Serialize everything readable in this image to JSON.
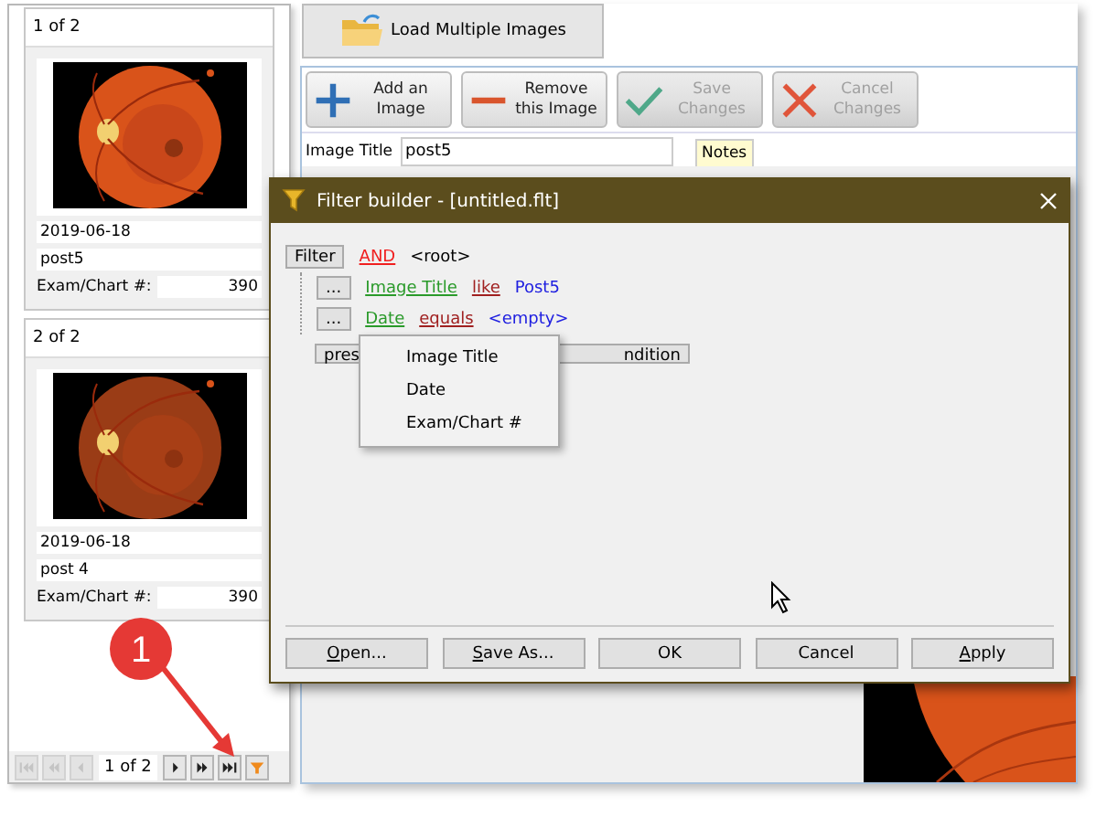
{
  "thumbnails": [
    {
      "header": "1 of 2",
      "date": "2019-06-18",
      "title": "post5",
      "exam_label": "Exam/Chart #:",
      "exam_value": "390"
    },
    {
      "header": "2 of 2",
      "date": "2019-06-18",
      "title": "post 4",
      "exam_label": "Exam/Chart #:",
      "exam_value": "390"
    }
  ],
  "navigator": {
    "position": "1 of 2",
    "buttons": [
      {
        "kind": "first",
        "disabled": true
      },
      {
        "kind": "prev_page",
        "disabled": true
      },
      {
        "kind": "prev",
        "disabled": true
      },
      {
        "kind": "next",
        "disabled": false
      },
      {
        "kind": "next_page",
        "disabled": false
      },
      {
        "kind": "last",
        "disabled": false
      },
      {
        "kind": "filter",
        "disabled": false
      }
    ]
  },
  "load_button": "Load Multiple Images",
  "toolbar": [
    {
      "kind": "plus",
      "label": "Add an Image",
      "disabled": false
    },
    {
      "kind": "minus",
      "label": "Remove this Image",
      "disabled": false
    },
    {
      "kind": "check",
      "label": "Save Changes",
      "disabled": true
    },
    {
      "kind": "cross",
      "label": "Cancel Changes",
      "disabled": true
    }
  ],
  "image_title": {
    "label": "Image Title",
    "value": "post5"
  },
  "notes_tab": "Notes",
  "dialog": {
    "title": "Filter builder - [untitled.flt]",
    "root": {
      "button": "Filter",
      "operator": "AND",
      "target": "<root>"
    },
    "conditions": [
      {
        "button": "...",
        "field": "Image Title",
        "operator": "like",
        "value": "Post5"
      },
      {
        "button": "...",
        "field": "Date",
        "operator": "equals",
        "value": "<empty>"
      }
    ],
    "hint_start": "pres",
    "hint_end": "ndition",
    "menu": [
      "Image Title",
      "Date",
      "Exam/Chart #"
    ],
    "buttons": [
      {
        "label": "Open...",
        "mnemonic": true
      },
      {
        "label": "Save As...",
        "mnemonic": true
      },
      {
        "label": "OK",
        "mnemonic": false
      },
      {
        "label": "Cancel",
        "mnemonic": false
      },
      {
        "label": "Apply",
        "mnemonic": true
      }
    ]
  },
  "callout": "1"
}
